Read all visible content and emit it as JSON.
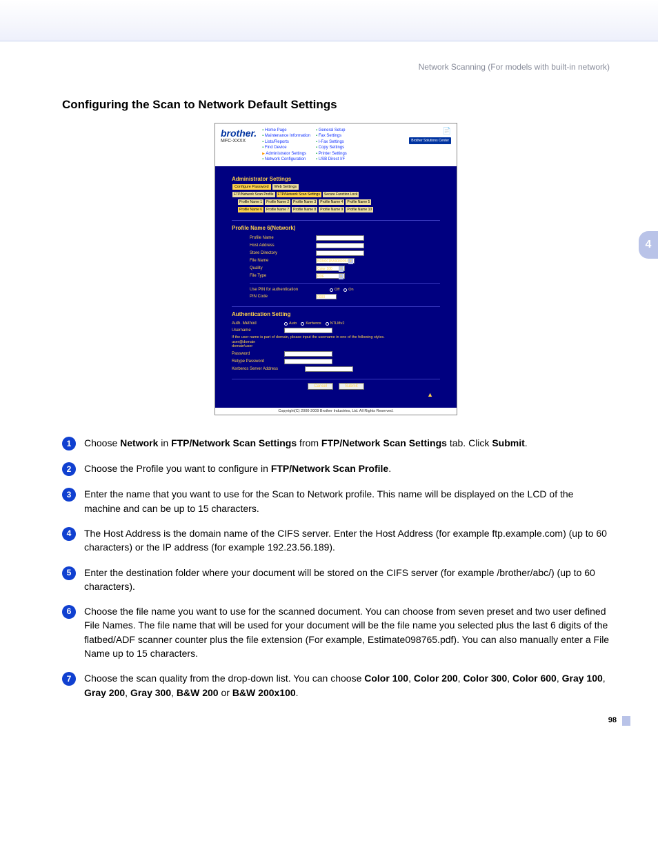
{
  "running_header": "Network Scanning (For models with built-in network)",
  "section_title": "Configuring the Scan to Network Default Settings",
  "chapter_tab": "4",
  "page_number": "98",
  "screenshot": {
    "brand": "brother.",
    "model": "MFC-XXXX",
    "nav_col1": [
      "Home Page",
      "Maintenance Information",
      "Lists/Reports",
      "Find Device",
      "Administrator Settings",
      "Network Configuration"
    ],
    "nav_col2": [
      "General Setup",
      "Fax Settings",
      "I-Fax Settings",
      "Copy Settings",
      "Printer Settings",
      "USB Direct I/F"
    ],
    "badge": "Brother Solutions Center",
    "admin_heading": "Administrator Settings",
    "tabs1": [
      "Configure Password",
      "Web Settings"
    ],
    "tabs2": [
      "FTP/Network Scan Profile",
      "FTP/Network Scan Settings",
      "Secure Function Lock"
    ],
    "tabs3": [
      "Profile Name 1",
      "Profile Name 2",
      "Profile Name 3",
      "Profile Name 4",
      "Profile Name 5"
    ],
    "tabs4": [
      "Profile Name 6",
      "Profile Name 7",
      "Profile Name 8",
      "Profile Name 9",
      "Profile Name 10"
    ],
    "profile_heading": "Profile Name 6(Network)",
    "fields": {
      "profile_name": "Profile Name",
      "host_address": "Host Address",
      "store_directory": "Store Directory",
      "file_name": "File Name",
      "file_name_value": "BRN001BA9089054",
      "quality": "Quality",
      "quality_value": "Color 100",
      "file_type": "File Type",
      "file_type_value": "PDF",
      "use_pin": "Use PIN for authentication",
      "pin_off": "Off",
      "pin_on": "On",
      "pin_code": "PIN Code",
      "pin_code_value": "0000"
    },
    "auth_heading": "Authentication Setting",
    "auth": {
      "method": "Auth. Method",
      "auto": "Auto",
      "kerberos": "Kerberos",
      "ntlmv2": "NTLMv2",
      "username": "Username",
      "hint": "If the user name is part of domain, please input the username in one of the following styles.",
      "hint2": "user@domain",
      "hint3": "domain\\user",
      "password": "Password",
      "retype": "Retype Password",
      "kerb_server": "Kerberos Server Address"
    },
    "cancel": "Cancel",
    "submit": "Submit",
    "totop": "▲",
    "copyright": "Copyright(C) 2000-2009 Brother Industries, Ltd. All Rights Reserved."
  },
  "steps": {
    "s1_a": "Choose ",
    "s1_b": "Network",
    "s1_c": " in ",
    "s1_d": "FTP/Network Scan Settings",
    "s1_e": " from ",
    "s1_f": "FTP/Network Scan Settings",
    "s1_g": " tab. Click ",
    "s1_h": "Submit",
    "s1_i": ".",
    "s2_a": "Choose the Profile you want to configure in ",
    "s2_b": "FTP/Network Scan Profile",
    "s2_c": ".",
    "s3": "Enter the name that you want to use for the Scan to Network profile. This name will be displayed on the LCD of the machine and can be up to 15 characters.",
    "s4": "The Host Address is the domain name of the CIFS server. Enter the Host Address (for example ftp.example.com) (up to 60 characters) or the IP address (for example 192.23.56.189).",
    "s5": "Enter the destination folder where your document will be stored on the CIFS server (for example /brother/abc/) (up to 60 characters).",
    "s6": "Choose the file name you want to use for the scanned document. You can choose from seven preset and two user defined File Names. The file name that will be used for your document will be the file name you selected plus the last 6 digits of the flatbed/ADF scanner counter plus the file extension (For example, Estimate098765.pdf). You can also manually enter a File Name up to 15 characters.",
    "s7_a": "Choose the scan quality from the drop-down list. You can choose ",
    "s7_opts": [
      "Color 100",
      "Color 200",
      "Color 300",
      "Color 600",
      "Gray 100",
      "Gray 200",
      "Gray 300",
      "B&W 200"
    ],
    "s7_or": " or ",
    "s7_last": "B&W 200x100",
    "s7_end": "."
  }
}
